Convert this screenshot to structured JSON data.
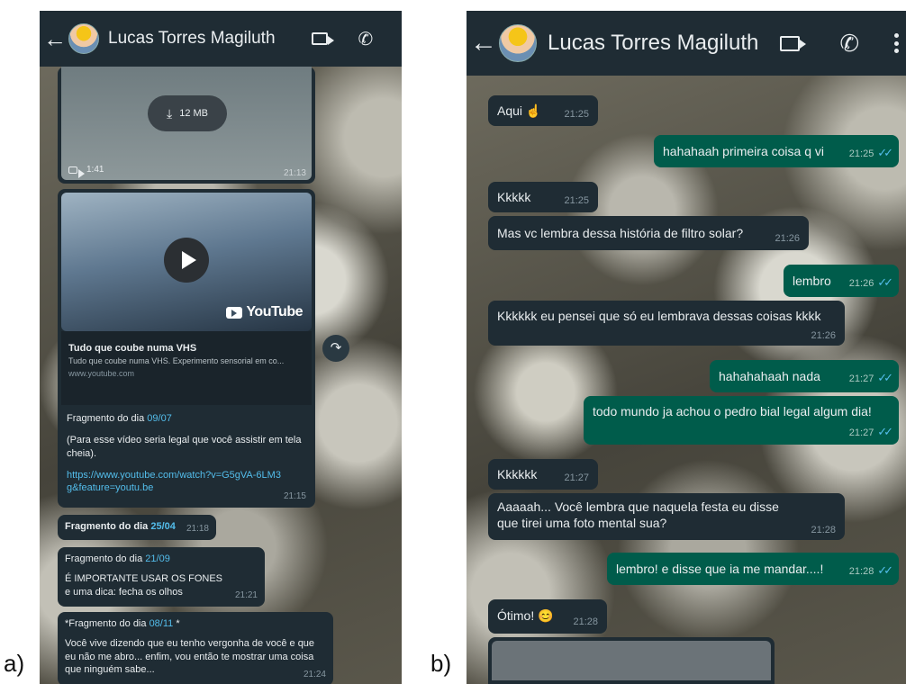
{
  "labels": {
    "a": "a)",
    "b": "b)"
  },
  "contact": {
    "name": "Lucas Torres Magiluth"
  },
  "icons": {
    "back": "arrow-left-icon",
    "video": "video-camera-icon",
    "phone": "phone-icon",
    "menu": "kebab-menu-icon",
    "forward": "forward-icon",
    "download": "download-icon",
    "play": "play-icon"
  },
  "colors": {
    "header": "#1f2c34",
    "incoming": "#1f2c34",
    "outgoing": "#005c4b",
    "link": "#53bdeb",
    "ticks": "#53bdeb"
  },
  "panel_a": {
    "video_msg": {
      "size": "12 MB",
      "duration": "1:41",
      "time": "21:13"
    },
    "youtube_msg": {
      "brand": "YouTube",
      "title": "Tudo que coube numa VHS",
      "desc": "Tudo que coube numa VHS. Experimento sensorial em co...",
      "domain": "www.youtube.com",
      "text1_prefix": "Fragmento do dia ",
      "text1_date": "09/07",
      "text2": "(Para esse vídeo seria legal que você assistir em tela cheia).",
      "url": "https://www.youtube.com/watch?v=G5gVA-6LM3g&feature=youtu.be",
      "time": "21:15"
    },
    "msg3": {
      "prefix": "Fragmento do dia ",
      "date": "25/04",
      "time": "21:18"
    },
    "msg4": {
      "prefix": "Fragmento do dia ",
      "date": "21/09",
      "line1": "É IMPORTANTE USAR OS FONES",
      "line2": "e uma dica: fecha os olhos",
      "time": "21:21"
    },
    "msg5": {
      "prefix": "*Fragmento do dia ",
      "date": "08/11",
      "suffix": " *",
      "body": "Você vive dizendo que eu tenho vergonha de você e que eu não me abro... enfim, vou então te mostrar uma coisa que ninguém sabe...",
      "time": "21:24"
    }
  },
  "panel_b": {
    "messages": [
      {
        "dir": "in",
        "text": "Aqui ☝",
        "time": "21:25"
      },
      {
        "dir": "out",
        "text": "hahahaah primeira coisa q vi",
        "time": "21:25"
      },
      {
        "dir": "in",
        "text": "Kkkkk",
        "time": "21:25"
      },
      {
        "dir": "in",
        "text": "Mas vc lembra dessa história de filtro solar?",
        "time": "21:26"
      },
      {
        "dir": "out",
        "text": "lembro",
        "time": "21:26"
      },
      {
        "dir": "in",
        "text": "Kkkkkk eu pensei que só eu lembrava dessas coisas kkkk",
        "time": "21:26"
      },
      {
        "dir": "out",
        "text": "hahahahaah nada",
        "time": "21:27"
      },
      {
        "dir": "out",
        "text": "todo mundo ja achou o pedro bial legal algum dia!",
        "time": "21:27"
      },
      {
        "dir": "in",
        "text": "Kkkkkk",
        "time": "21:27"
      },
      {
        "dir": "in",
        "text": "Aaaaah... Você lembra que naquela festa eu disse que tirei uma foto mental sua?",
        "time": "21:28"
      },
      {
        "dir": "out",
        "text": "lembro! e disse que ia me mandar....!",
        "time": "21:28"
      },
      {
        "dir": "in",
        "text": "Ótimo! 😊",
        "time": "21:28"
      }
    ]
  }
}
